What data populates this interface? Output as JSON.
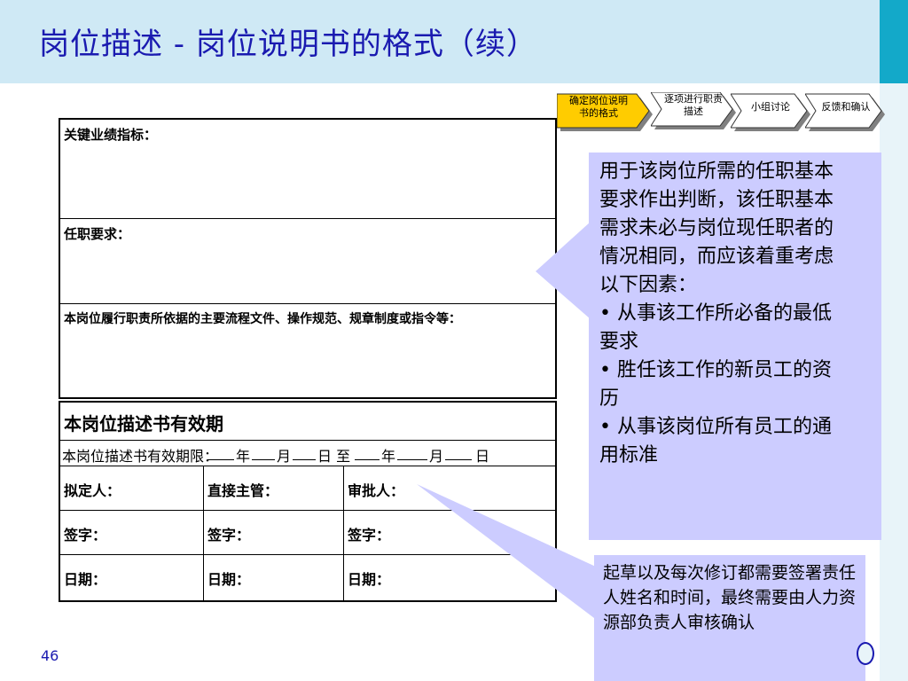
{
  "title": "岗位描述 - 岗位说明书的格式（续）",
  "colors": {
    "title_bg": "#cfe9f5",
    "title_text": "#1a1ab0",
    "accent": "#13a9c9",
    "callout_bg": "#ccccff",
    "step_active": "#ffcc00"
  },
  "steps": [
    {
      "label": "确定岗位说明书的格式",
      "active": true
    },
    {
      "label": "逐项进行职责描述",
      "active": false
    },
    {
      "label": "小组讨论",
      "active": false
    },
    {
      "label": "反馈和确认",
      "active": false
    }
  ],
  "form": {
    "kpi_label": "关键业绩指标：",
    "requirements_label": "任职要求：",
    "basis_label": "本岗位履行职责所依据的主要流程文件、操作规范、规章制度或指令等：",
    "validity_title": "本岗位描述书有效期",
    "validity_label": "本岗位描述书有效期限：",
    "validity_parts": [
      "年",
      "月",
      "日 至",
      "年",
      "月",
      "日"
    ],
    "drafter_label": "拟定人：",
    "supervisor_label": "直接主管：",
    "approver_label": "审批人：",
    "sign_label": "签字：",
    "date_label": "日期："
  },
  "callout1": {
    "intro": "用于该岗位所需的任职基本要求作出判断，该任职基本需求未必与岗位现任职者的情况相同，而应该着重考虑以下因素：",
    "bullets": [
      "•  从事该工作所必备的最低要求",
      "•  胜任该工作的新员工的资历",
      "•  从事该岗位所有员工的通用标准"
    ]
  },
  "callout2": {
    "text": "起草以及每次修订都需要签署责任人姓名和时间，最终需要由人力资源部负责人审核确认"
  },
  "page_number": "46"
}
